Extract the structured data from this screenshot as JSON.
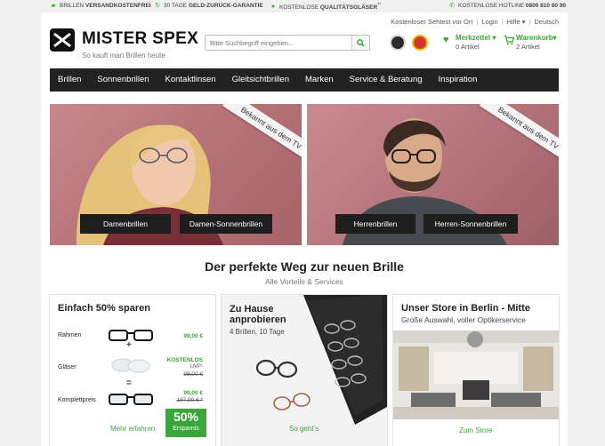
{
  "topbar": {
    "usp1_plain": "BRILLEN ",
    "usp1_bold": "VERSANDKOSTENFREI",
    "usp2_plain": "30 TAGE ",
    "usp2_bold": "GELD-ZURÜCK-GARANTIE",
    "usp3_plain": "KOSTENLOSE ",
    "usp3_bold": "QUALITÄTSGLÄSER",
    "usp3_sup": "**",
    "hotline_plain": "KOSTENLOSE HOTLINE ",
    "hotline_bold": "0800 810 80 90"
  },
  "header": {
    "logo_name": "MISTER SPEX",
    "logo_tagline": "So kauft man Brillen heute",
    "search_placeholder": "Bitte Suchbegriff eingeben...",
    "utility_links": {
      "eye_test": "Kostenloser Sehtest vor Ort",
      "login": "Login",
      "help": "Hilfe ▾",
      "language": "Deutsch"
    },
    "wishlist_label": "Merkzettel ▾",
    "wishlist_count": "0 Artikel",
    "cart_label": "Warenkorb▾",
    "cart_count": "2 Artikel"
  },
  "nav": [
    "Brillen",
    "Sonnenbrillen",
    "Kontaktlinsen",
    "Gleitsichtbrillen",
    "Marken",
    "Service & Beratung",
    "Inspiration"
  ],
  "hero_left": {
    "ribbon": "Bekannt aus dem TV",
    "btn1": "Damenbrillen",
    "btn2": "Damen-Sonnenbrillen"
  },
  "hero_right": {
    "ribbon": "Bekannt aus dem TV",
    "btn1": "Herrenbrillen",
    "btn2": "Herren-Sonnenbrillen"
  },
  "section": {
    "headline": "Der perfekte Weg zur neuen Brille",
    "subline": "Alle Vorteile & Services"
  },
  "card_savings": {
    "title": "Einfach 50% sparen",
    "frame_label": "Rahmen",
    "frame_price": "99,00 €",
    "lenses_label": "Gläser",
    "lenses_free": "KOSTENLOS",
    "lenses_uvp": "UVP¹",
    "lenses_old": "98,00 €",
    "total_label": "Komplettpreis",
    "total_price": "99,00 €",
    "total_old": "197,00 € *",
    "op_plus": "+",
    "op_equals": "=",
    "badge_pct": "50%",
    "badge_label": "Ersparnis",
    "cta": "Mehr erfahren"
  },
  "card_home": {
    "title": "Zu Hause anprobieren",
    "subtitle": "4 Brillen, 10 Tage",
    "cta": "So geht's"
  },
  "card_store": {
    "title": "Unser Store in Berlin - Mitte",
    "subtitle": "Große Auswahl, voller Optikerservice",
    "cta": "Zum Store"
  },
  "colors": {
    "accent_green": "#3aa63a",
    "nav_bg": "#222222",
    "hero_pink": "#b77479"
  }
}
